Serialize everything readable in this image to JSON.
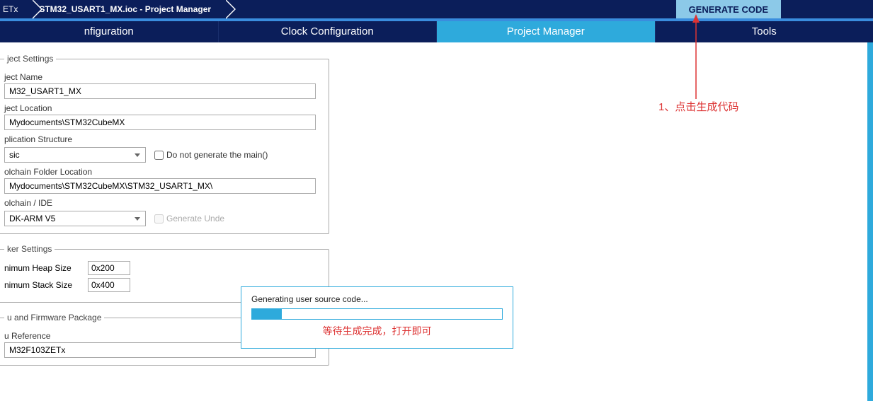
{
  "breadcrumbs": {
    "item0": "ETx",
    "item1": "STM32_USART1_MX.ioc - Project Manager"
  },
  "generate_button": "GENERATE CODE",
  "tabs": {
    "t0": "nfiguration",
    "t1": "Clock Configuration",
    "t2": "Project Manager",
    "t3": "Tools"
  },
  "project_settings": {
    "legend": "ject Settings",
    "name_label": "ject Name",
    "name_value": "M32_USART1_MX",
    "location_label": "ject Location",
    "location_value": "Mydocuments\\STM32CubeMX",
    "app_struct_label": "plication Structure",
    "app_struct_value": "sic",
    "no_main_label": "Do not generate the main()",
    "toolchain_folder_label": "olchain Folder Location",
    "toolchain_folder_value": "Mydocuments\\STM32CubeMX\\STM32_USART1_MX\\",
    "toolchain_ide_label": "olchain / IDE",
    "toolchain_ide_value": "DK-ARM V5",
    "gen_under_label": "Generate Unde"
  },
  "linker_settings": {
    "legend": "ker Settings",
    "heap_label": "nimum Heap Size",
    "heap_value": "0x200",
    "stack_label": "nimum Stack Size",
    "stack_value": "0x400"
  },
  "firmware": {
    "legend": "u and Firmware Package",
    "ref_label": "u Reference",
    "ref_value": "M32F103ZETx"
  },
  "progress": {
    "msg": "Generating user source code...",
    "note": "等待生成完成，打开即可"
  },
  "annotation": {
    "text": "1、点击生成代码"
  }
}
